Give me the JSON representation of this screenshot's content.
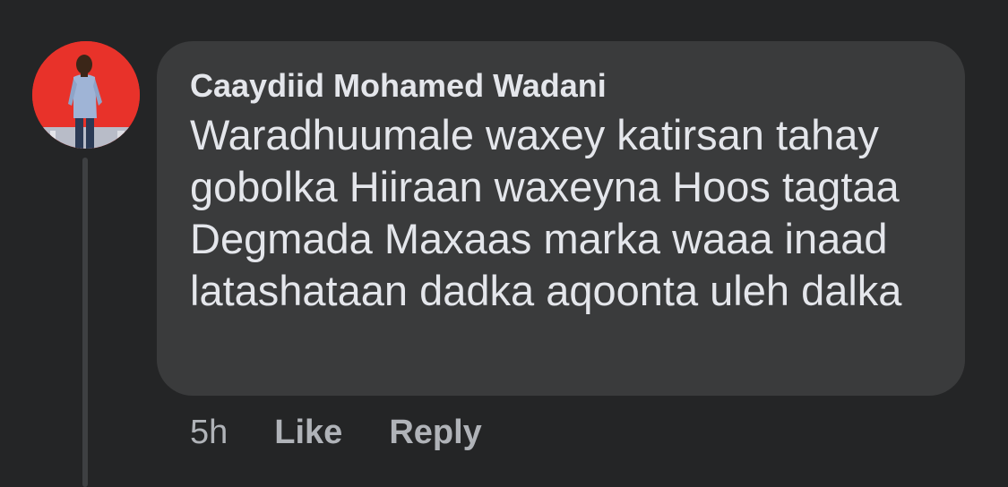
{
  "comment": {
    "author": "Caaydiid Mohamed Wadani",
    "text": "Waradhuumale waxey katirsan tahay gobolka Hiiraan waxeyna Hoos tagtaa Degmada Maxaas marka waaa inaad latashataan dadka aqoonta uleh dalka",
    "time": "5h",
    "like_label": "Like",
    "reply_label": "Reply"
  },
  "colors": {
    "background": "#242526",
    "bubble": "#3a3b3c",
    "text": "#e4e6eb",
    "meta_text": "#b0b3b8",
    "avatar_bg": "#e8322a"
  }
}
